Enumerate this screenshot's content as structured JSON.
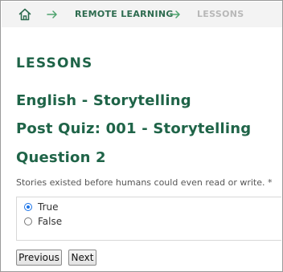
{
  "breadcrumb": {
    "home_icon": "home-icon",
    "separator_icon": "arrow-right-icon",
    "items": [
      {
        "label": "REMOTE LEARNING"
      },
      {
        "label": "LESSONS"
      }
    ]
  },
  "page": {
    "section_title": "LESSONS",
    "course_title": "English - Storytelling",
    "quiz_title": "Post Quiz: 001 - Storytelling",
    "question_title": "Question 2"
  },
  "question": {
    "prompt": "Stories existed before humans could even read or write. *",
    "options": [
      {
        "label": "True",
        "selected": true
      },
      {
        "label": "False",
        "selected": false
      }
    ]
  },
  "nav": {
    "previous_label": "Previous",
    "next_label": "Next"
  },
  "colors": {
    "heading": "#1f6448",
    "breadcrumb_link": "#2d6b4f",
    "breadcrumb_current": "#b8b8b8",
    "radio_selected": "#1a73e8"
  }
}
